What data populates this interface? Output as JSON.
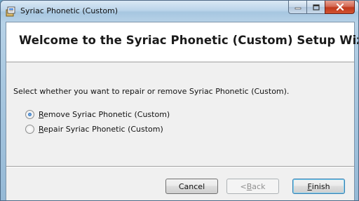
{
  "window": {
    "title": "Syriac Phonetic (Custom)"
  },
  "banner": {
    "title": "Welcome to the Syriac Phonetic (Custom) Setup Wizard"
  },
  "content": {
    "description": "Select whether you want to repair or remove Syriac Phonetic (Custom).",
    "options": [
      {
        "mnemonic": "R",
        "rest": "emove Syriac Phonetic (Custom)",
        "selected": true
      },
      {
        "mnemonic": "R",
        "rest": "epair Syriac Phonetic (Custom)",
        "selected": false
      }
    ]
  },
  "buttons": {
    "cancel": "Cancel",
    "back_prefix": "< ",
    "back_mnemonic": "B",
    "back_rest": "ack",
    "finish_mnemonic": "F",
    "finish_rest": "inish"
  }
}
